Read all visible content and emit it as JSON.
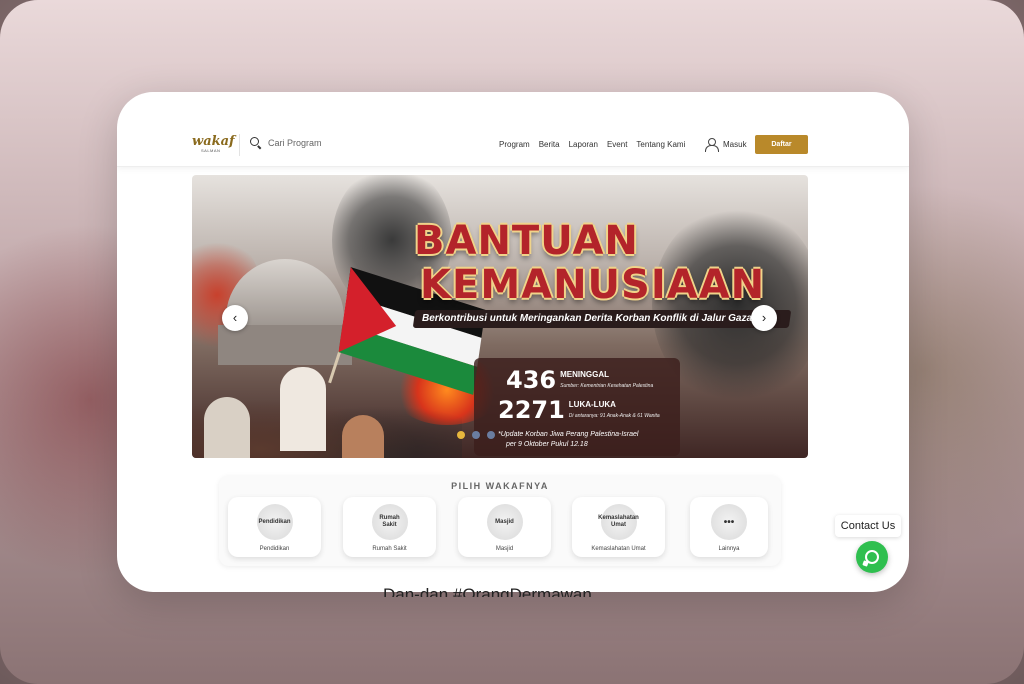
{
  "header": {
    "logo_text": "wakaf",
    "logo_sub": "SALMAN",
    "search_placeholder": "Cari Program",
    "menu": [
      "Program",
      "Berita",
      "Laporan",
      "Event",
      "Tentang Kami"
    ],
    "login_label": "Masuk",
    "register_label": "Daftar",
    "register_color": "#b9892a"
  },
  "banner": {
    "title_line1": "BANTUAN",
    "title_line2": "KEMANUSIAAN",
    "subtitle": "Berkontribusi untuk Meringankan Derita Korban Konflik di Jalur Gaza",
    "stats": [
      {
        "number": "436",
        "label": "MENINGGAL",
        "sub": "Sumber: Kementrian Kesehatan Palestina"
      },
      {
        "number": "2271",
        "label": "LUKA-LUKA",
        "sub": "Di antaranya: 91 Anak-Anak & 61 Wanita"
      }
    ],
    "update_line1": "*Update Korban Jiwa Perang Palestina-Israel",
    "update_line2": "per 9 Oktober Pukul 12.18",
    "prev_icon": "chevron-left-icon",
    "next_icon": "chevron-right-icon",
    "slide_count": 3,
    "active_slide": 1
  },
  "categories": {
    "title": "PILIH WAKAFNYA",
    "items": [
      {
        "icon_text": "Pendidikan",
        "label": "Pendidikan"
      },
      {
        "icon_text": "Rumah Sakit",
        "label": "Rumah Sakit"
      },
      {
        "icon_text": "Masjid",
        "label": "Masjid"
      },
      {
        "icon_text": "Kemaslahatan Umat",
        "label": "Kemaslahatan Umat"
      },
      {
        "icon_text": "•••",
        "label": "Lainnya"
      }
    ]
  },
  "below_text": "Dan-dan #OrangDermawan",
  "contact": {
    "label": "Contact Us",
    "icon": "whatsapp-icon",
    "color": "#2fbf4f"
  }
}
